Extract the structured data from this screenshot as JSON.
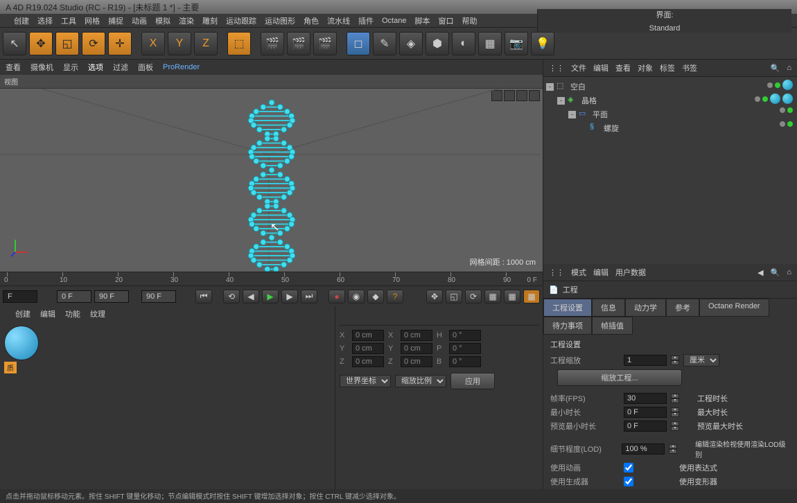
{
  "title": "A 4D R19.024 Studio (RC - R19) - [未标题 1 *] - 主要",
  "menu": [
    "",
    "创建",
    "选择",
    "工具",
    "网格",
    "捕捉",
    "动画",
    "模拟",
    "渲染",
    "雕刻",
    "运动跟踪",
    "运动图形",
    "角色",
    "流水线",
    "插件",
    "Octane",
    "脚本",
    "窗口",
    "帮助"
  ],
  "layout_label": "界面:",
  "layout_value": "Standard",
  "viewtabs": [
    "查看",
    "摄像机",
    "显示",
    "选项",
    "过滤",
    "面板",
    "ProRender"
  ],
  "viewlabel": "视图",
  "grid_info": "网格间距 : 1000 cm",
  "ruler": {
    "ticks": [
      0,
      10,
      20,
      30,
      40,
      50,
      60,
      70,
      80,
      90
    ],
    "endlabel": "0 F"
  },
  "time": {
    "startA": "F",
    "startB": "0 F",
    "endB": "90 F",
    "cur": "90 F"
  },
  "bottom_tabs": [
    "",
    "创建",
    "编辑",
    "功能",
    "纹理"
  ],
  "mat_label": "质",
  "coord": {
    "x": "0 cm",
    "y": "0 cm",
    "z": "0 cm",
    "sx": "0 cm",
    "sy": "0 cm",
    "sz": "0 cm",
    "h": "0 °",
    "p": "0 °",
    "b": "0 °",
    "sel1": "世界坐标",
    "sel2": "缩放比例",
    "apply": "应用"
  },
  "obj_menu": [
    "文件",
    "编辑",
    "查看",
    "对象",
    "标签",
    "书签"
  ],
  "objects": [
    {
      "indent": 0,
      "exp": "-",
      "icon": "null",
      "name": "空白"
    },
    {
      "indent": 1,
      "exp": "-",
      "icon": "cloner",
      "name": "晶格"
    },
    {
      "indent": 2,
      "exp": "-",
      "icon": "plane",
      "name": "平面"
    },
    {
      "indent": 3,
      "exp": "",
      "icon": "helix",
      "name": "螺旋"
    }
  ],
  "attr_menu": [
    "模式",
    "编辑",
    "用户数据"
  ],
  "attr_header": "工程",
  "attr_tabs_row1": [
    "工程设置",
    "信息",
    "动力学",
    "参考"
  ],
  "attr_tabs_row2": [
    "Octane Render",
    "待力事项",
    "帧插值"
  ],
  "attr_section": "工程设置",
  "attrs": {
    "scale_lbl": "工程缩放",
    "scale_val": "1",
    "scale_unit": "厘米",
    "scalebtn": "缩放工程...",
    "fps_lbl": "帧率(FPS)",
    "fps_val": "30",
    "proj_time_lbl": "工程时长",
    "min_lbl": "最小时长",
    "min_val": "0 F",
    "max_lbl": "最大时长",
    "prevmin_lbl": "预览最小时长",
    "prevmin_val": "0 F",
    "prevmax_lbl": "预览最大时长",
    "lod_lbl": "细节程度(LOD)",
    "lod_val": "100 %",
    "lod_right": "编辑渲染检视使用渲染LOD级别",
    "useanim_lbl": "使用动画",
    "useexpr_lbl": "使用表达式",
    "usegen_lbl": "使用生成器",
    "usedef_lbl": "使用变形器"
  },
  "status": "点击并拖动鼠标移动元素。按住 SHIFT 键量化移动；节点编辑模式时按住 SHIFT 键增加选择对象；按住 CTRL 键减少选择对象。"
}
